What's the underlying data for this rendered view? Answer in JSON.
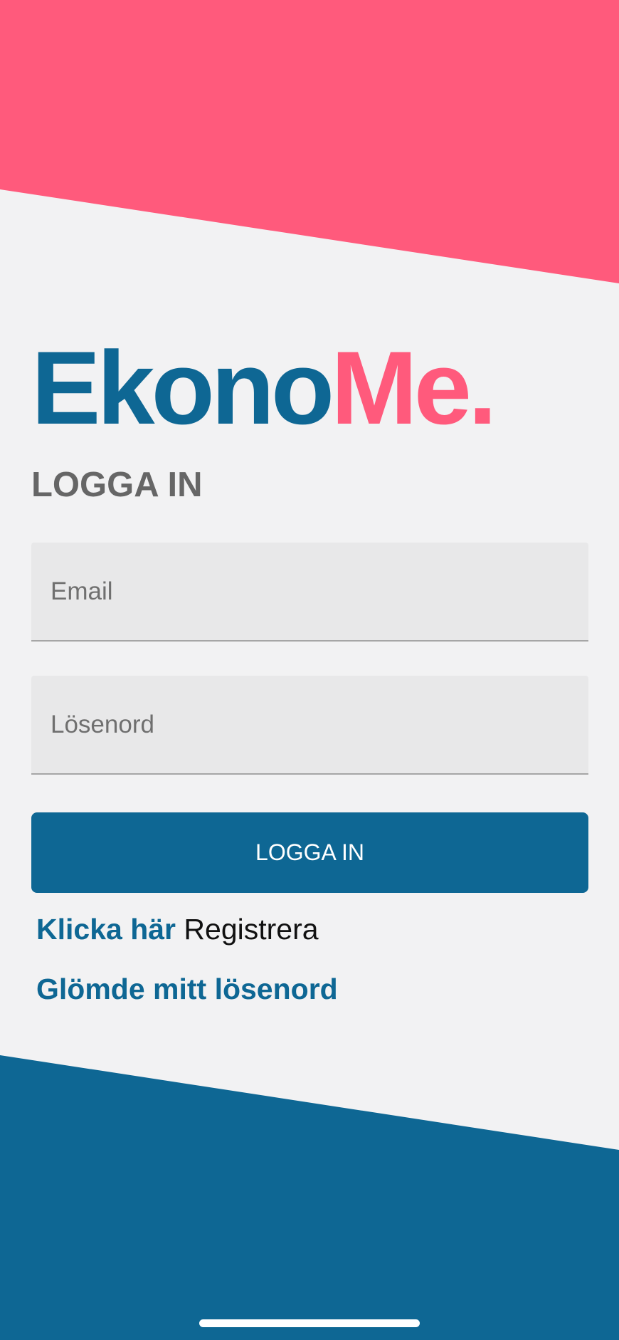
{
  "logo": {
    "part_a": "Ekono",
    "part_b": "Me."
  },
  "page_title": "LOGGA IN",
  "form": {
    "email_placeholder": "Email",
    "password_placeholder": "Lösenord",
    "submit_label": "LOGGA IN"
  },
  "links": {
    "register_prompt": "Klicka här",
    "register_label": "Registrera",
    "forgot_password": "Glömde mitt lösenord"
  },
  "colors": {
    "brand_blue": "#0e6794",
    "brand_pink": "#ff5a7c",
    "background": "#f2f2f3",
    "field_background": "#e8e8e9",
    "heading_gray": "#666666"
  }
}
